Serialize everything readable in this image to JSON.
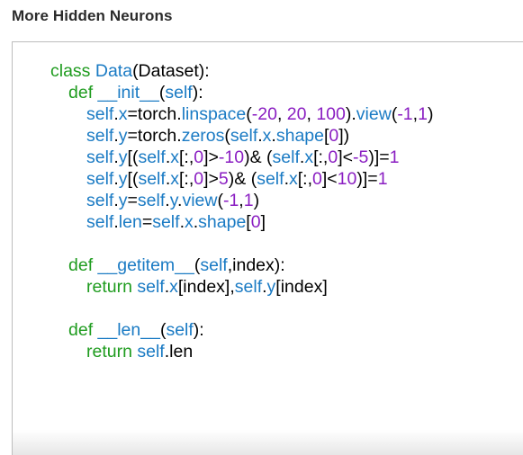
{
  "page": {
    "title": "More Hidden Neurons"
  },
  "colors": {
    "keyword": "#1f9c1f",
    "identifier": "#1b7bc4",
    "number": "#8a1ec2",
    "plain": "#000000",
    "title": "#2b2b2b",
    "border": "#bdbdbd"
  },
  "code": {
    "lines": [
      {
        "indent": 0,
        "tokens": [
          [
            "kw",
            "class "
          ],
          [
            "id",
            "Data"
          ],
          [
            "plain",
            "(Dataset):"
          ]
        ]
      },
      {
        "indent": 1,
        "tokens": [
          [
            "kw",
            "def "
          ],
          [
            "id",
            "__init__"
          ],
          [
            "plain",
            "("
          ],
          [
            "id",
            "self"
          ],
          [
            "plain",
            "):"
          ]
        ]
      },
      {
        "indent": 2,
        "tokens": [
          [
            "id",
            "self"
          ],
          [
            "plain",
            "."
          ],
          [
            "id",
            "x"
          ],
          [
            "plain",
            "=torch."
          ],
          [
            "id",
            "linspace"
          ],
          [
            "plain",
            "("
          ],
          [
            "num",
            "-20"
          ],
          [
            "plain",
            ", "
          ],
          [
            "num",
            "20"
          ],
          [
            "plain",
            ", "
          ],
          [
            "num",
            "100"
          ],
          [
            "plain",
            ")."
          ],
          [
            "id",
            "view"
          ],
          [
            "plain",
            "("
          ],
          [
            "num",
            "-1"
          ],
          [
            "plain",
            ","
          ],
          [
            "num",
            "1"
          ],
          [
            "plain",
            ")"
          ]
        ]
      },
      {
        "indent": 2,
        "tokens": [
          [
            "id",
            "self"
          ],
          [
            "plain",
            "."
          ],
          [
            "id",
            "y"
          ],
          [
            "plain",
            "=torch."
          ],
          [
            "id",
            "zeros"
          ],
          [
            "plain",
            "("
          ],
          [
            "id",
            "self"
          ],
          [
            "plain",
            "."
          ],
          [
            "id",
            "x"
          ],
          [
            "plain",
            "."
          ],
          [
            "id",
            "shape"
          ],
          [
            "plain",
            "["
          ],
          [
            "num",
            "0"
          ],
          [
            "plain",
            "])"
          ]
        ]
      },
      {
        "indent": 2,
        "tokens": [
          [
            "id",
            "self"
          ],
          [
            "plain",
            "."
          ],
          [
            "id",
            "y"
          ],
          [
            "plain",
            "[("
          ],
          [
            "id",
            "self"
          ],
          [
            "plain",
            "."
          ],
          [
            "id",
            "x"
          ],
          [
            "plain",
            "[:,"
          ],
          [
            "num",
            "0"
          ],
          [
            "plain",
            "]>"
          ],
          [
            "num",
            "-10"
          ],
          [
            "plain",
            ")& ("
          ],
          [
            "id",
            "self"
          ],
          [
            "plain",
            "."
          ],
          [
            "id",
            "x"
          ],
          [
            "plain",
            "[:,"
          ],
          [
            "num",
            "0"
          ],
          [
            "plain",
            "]<"
          ],
          [
            "num",
            "-5"
          ],
          [
            "plain",
            ")]="
          ],
          [
            "num",
            "1"
          ]
        ]
      },
      {
        "indent": 2,
        "tokens": [
          [
            "id",
            "self"
          ],
          [
            "plain",
            "."
          ],
          [
            "id",
            "y"
          ],
          [
            "plain",
            "[("
          ],
          [
            "id",
            "self"
          ],
          [
            "plain",
            "."
          ],
          [
            "id",
            "x"
          ],
          [
            "plain",
            "[:,"
          ],
          [
            "num",
            "0"
          ],
          [
            "plain",
            "]>"
          ],
          [
            "num",
            "5"
          ],
          [
            "plain",
            ")& ("
          ],
          [
            "id",
            "self"
          ],
          [
            "plain",
            "."
          ],
          [
            "id",
            "x"
          ],
          [
            "plain",
            "[:,"
          ],
          [
            "num",
            "0"
          ],
          [
            "plain",
            "]<"
          ],
          [
            "num",
            "10"
          ],
          [
            "plain",
            ")]="
          ],
          [
            "num",
            "1"
          ]
        ]
      },
      {
        "indent": 2,
        "tokens": [
          [
            "id",
            "self"
          ],
          [
            "plain",
            "."
          ],
          [
            "id",
            "y"
          ],
          [
            "plain",
            "="
          ],
          [
            "id",
            "self"
          ],
          [
            "plain",
            "."
          ],
          [
            "id",
            "y"
          ],
          [
            "plain",
            "."
          ],
          [
            "id",
            "view"
          ],
          [
            "plain",
            "("
          ],
          [
            "num",
            "-1"
          ],
          [
            "plain",
            ","
          ],
          [
            "num",
            "1"
          ],
          [
            "plain",
            ")"
          ]
        ]
      },
      {
        "indent": 2,
        "tokens": [
          [
            "id",
            "self"
          ],
          [
            "plain",
            "."
          ],
          [
            "id",
            "len"
          ],
          [
            "plain",
            "="
          ],
          [
            "id",
            "self"
          ],
          [
            "plain",
            "."
          ],
          [
            "id",
            "x"
          ],
          [
            "plain",
            "."
          ],
          [
            "id",
            "shape"
          ],
          [
            "plain",
            "["
          ],
          [
            "num",
            "0"
          ],
          [
            "plain",
            "]"
          ]
        ]
      },
      {
        "indent": 0,
        "tokens": []
      },
      {
        "indent": 1,
        "tokens": [
          [
            "kw",
            "def "
          ],
          [
            "id",
            "__getitem__"
          ],
          [
            "plain",
            "("
          ],
          [
            "id",
            "self"
          ],
          [
            "plain",
            ",index):"
          ]
        ]
      },
      {
        "indent": 2,
        "tokens": [
          [
            "kw",
            "return "
          ],
          [
            "id",
            "self"
          ],
          [
            "plain",
            "."
          ],
          [
            "id",
            "x"
          ],
          [
            "plain",
            "[index],"
          ],
          [
            "id",
            "self"
          ],
          [
            "plain",
            "."
          ],
          [
            "id",
            "y"
          ],
          [
            "plain",
            "[index]"
          ]
        ]
      },
      {
        "indent": 0,
        "tokens": []
      },
      {
        "indent": 1,
        "tokens": [
          [
            "kw",
            "def "
          ],
          [
            "id",
            "__len__"
          ],
          [
            "plain",
            "("
          ],
          [
            "id",
            "self"
          ],
          [
            "plain",
            "):"
          ]
        ]
      },
      {
        "indent": 2,
        "tokens": [
          [
            "kw",
            "return "
          ],
          [
            "id",
            "self"
          ],
          [
            "plain",
            ".len"
          ]
        ]
      }
    ]
  }
}
